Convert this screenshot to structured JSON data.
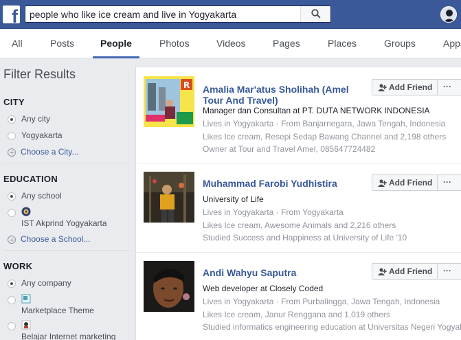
{
  "header": {
    "search_value": "people who like ice cream and live in Yogyakarta",
    "logo_letter": "f",
    "icons": {
      "logo": "facebook-logo",
      "search": "search-icon",
      "profile": "profile-avatar"
    },
    "brand_color": "#3b5998"
  },
  "tabs": [
    {
      "label": "All"
    },
    {
      "label": "Posts"
    },
    {
      "label": "People",
      "active": true
    },
    {
      "label": "Photos"
    },
    {
      "label": "Videos"
    },
    {
      "label": "Pages"
    },
    {
      "label": "Places"
    },
    {
      "label": "Groups"
    },
    {
      "label": "Apps"
    }
  ],
  "sidebar": {
    "title": "Filter Results",
    "city": {
      "title": "CITY",
      "any": "Any city",
      "option": "Yogyakarta",
      "choose": "Choose a City..."
    },
    "education": {
      "title": "EDUCATION",
      "any": "Any school",
      "option": "IST Akprind Yogyakarta",
      "choose": "Choose a School..."
    },
    "work": {
      "title": "WORK",
      "any": "Any company",
      "option1": "Marketplace Theme",
      "option2": "Belajar Internet marketing"
    }
  },
  "results": [
    {
      "name": "Amalia Mar'atus Sholihah (Amel Tour And Travel)",
      "headline": "Manager dan Consultan at PT. DUTA NETWORK INDONESIA",
      "lives": "Lives in Yogyakarta · From Banjarnegara, Jawa Tengah, Indonesia",
      "likes": "Likes Ice cream, Resepi Sedap Bawang Channel and 2,198 others",
      "extra": "Owner at Tour and Travel Amel, 085647724482",
      "button": "Add Friend",
      "more": "···"
    },
    {
      "name": "Muhammad Farobi Yudhistira",
      "headline": "University of Life",
      "lives": "Lives in Yogyakarta · From Yogyakarta",
      "likes": "Likes Ice cream, Awesome Animals and 2,216 others",
      "extra": "Studied Success and Happiness at University of Life '10",
      "button": "Add Friend",
      "more": "···"
    },
    {
      "name": "Andi Wahyu Saputra",
      "headline": "Web developer at Closely Coded",
      "lives": "Lives in Yogyakarta · From Purbalingga, Jawa Tengah, Indonesia",
      "likes": "Likes Ice cream, Janur Renggana and 1,019 others",
      "extra": "Studied informatics engineering education at Universitas Negeri Yogyakarta",
      "button": "Add Friend",
      "more": "···"
    }
  ]
}
